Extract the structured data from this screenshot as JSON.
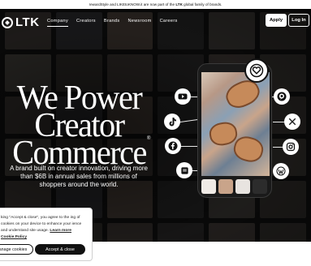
{
  "announcement": {
    "before": "rewardStyle and LIKEtoKNOW.it are now part of the ",
    "brand": "LTK",
    "after": " global family of brands."
  },
  "nav": {
    "logo_text": "LTK",
    "links": [
      "Company",
      "Creators",
      "Brands",
      "Newsroom",
      "Careers"
    ],
    "active_link": "Company",
    "apply_label": "Apply",
    "login_label": "Log In"
  },
  "hero": {
    "headline": "We Power Creator Commerce",
    "registered_mark": "®",
    "subtext": "A brand built on creator innovation, driving more than $6B in annual sales from millions of shoppers around the world."
  },
  "social_icons": [
    "youtube-icon",
    "tiktok-icon",
    "facebook-icon",
    "ltk-bookmark-icon",
    "pinterest-icon",
    "x-icon",
    "instagram-icon",
    "wordpress-icon"
  ],
  "cookie_banner": {
    "text_visible": "king \"Accept & close\", you agree to the ing of cookies on your device to enhance your ience and understand site usage.",
    "learn_more": "Learn more",
    "policy_link": "Cookie Policy",
    "manage_label": "anage cookies",
    "accept_label": "Accept & close"
  },
  "colors": {
    "background": "#0b0b0b",
    "text_on_dark": "#ffffff",
    "button_dark": "#111111"
  }
}
